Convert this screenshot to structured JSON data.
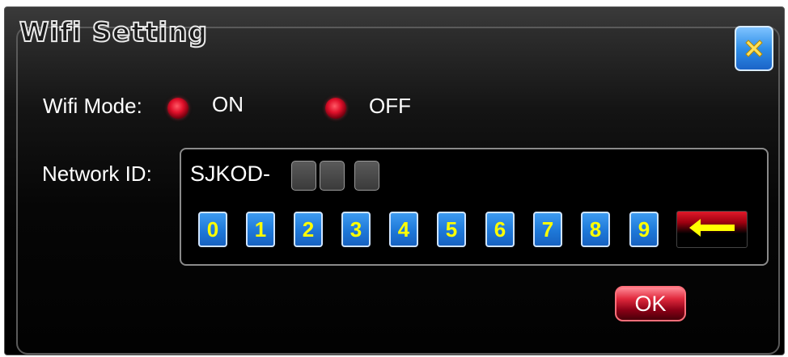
{
  "dialog": {
    "title": "Wifi Setting"
  },
  "wifi_mode": {
    "label": "Wifi Mode:",
    "on_label": "ON",
    "off_label": "OFF"
  },
  "network_id": {
    "label": "Network ID:",
    "prefix": "SJKOD-",
    "slots": [
      "",
      "",
      ""
    ]
  },
  "keypad": {
    "keys": [
      "0",
      "1",
      "2",
      "3",
      "4",
      "5",
      "6",
      "7",
      "8",
      "9"
    ],
    "backspace_icon": "left-arrow-icon"
  },
  "ok_label": "OK",
  "colors": {
    "key_bg": "#1e78d8",
    "key_text": "#ffff00",
    "radio": "#e0102a",
    "ok_bg": "#e0283c",
    "close_bg": "#2f8fe8"
  }
}
